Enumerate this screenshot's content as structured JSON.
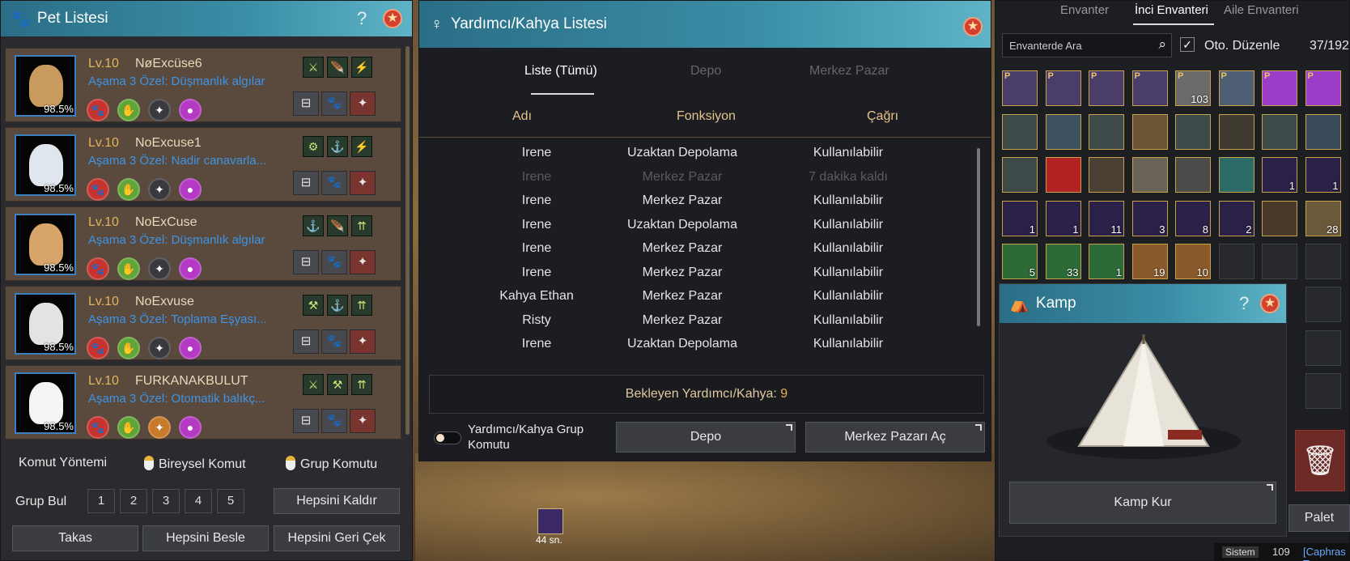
{
  "pet_list": {
    "title": "Pet Listesi",
    "help": "?",
    "pets": [
      {
        "level_prefix": "Lv.",
        "level": "10",
        "name": "NøExcüse6",
        "stage": "Aşama 3",
        "special": "Özel: Düşmanlık algılar",
        "loyalty": "98.5%",
        "color": "#c99b5e"
      },
      {
        "level_prefix": "Lv.",
        "level": "10",
        "name": "NoExcuse1",
        "stage": "Aşama 3",
        "special": "Özel: Nadir canavarla...",
        "loyalty": "98.5%",
        "color": "#dfe6ee"
      },
      {
        "level_prefix": "Lv.",
        "level": "10",
        "name": "NoExCuse",
        "stage": "Aşama 3",
        "special": "Özel: Düşmanlık algılar",
        "loyalty": "98.5%",
        "color": "#d7a46a"
      },
      {
        "level_prefix": "Lv.",
        "level": "10",
        "name": "NoExvuse",
        "stage": "Aşama 3",
        "special": "Özel: Toplama Eşyası...",
        "loyalty": "98.5%",
        "color": "#e3e3e6"
      },
      {
        "level_prefix": "Lv.",
        "level": "10",
        "name": "FURKANAKBULUT",
        "stage": "Aşama 3",
        "special": "Özel: Otomatik balıkç...",
        "loyalty": "98.5%",
        "color": "#f2f4f6"
      }
    ],
    "command_method": "Komut Yöntemi",
    "individual_command": "Bireysel Komut",
    "group_command": "Grup Komutu",
    "group_find": "Grup Bul",
    "group_numbers": [
      "1",
      "2",
      "3",
      "4",
      "5"
    ],
    "remove_all": "Hepsini Kaldır",
    "trade": "Takas",
    "feed_all": "Hepsini Besle",
    "recall_all": "Hepsini Geri Çek"
  },
  "helper_list": {
    "title": "Yardımcı/Kahya Listesi",
    "tabs": [
      "Liste (Tümü)",
      "Depo",
      "Merkez Pazar"
    ],
    "columns": [
      "Adı",
      "Fonksiyon",
      "Çağrı"
    ],
    "rows": [
      {
        "name": "Irene",
        "function": "Uzaktan Depolama",
        "status": "Kullanılabilir",
        "dim": false
      },
      {
        "name": "Irene",
        "function": "Merkez Pazar",
        "status": "7 dakika kaldı",
        "dim": true
      },
      {
        "name": "Irene",
        "function": "Merkez Pazar",
        "status": "Kullanılabilir",
        "dim": false
      },
      {
        "name": "Irene",
        "function": "Uzaktan Depolama",
        "status": "Kullanılabilir",
        "dim": false
      },
      {
        "name": "Irene",
        "function": "Merkez Pazar",
        "status": "Kullanılabilir",
        "dim": false
      },
      {
        "name": "Irene",
        "function": "Merkez Pazar",
        "status": "Kullanılabilir",
        "dim": false
      },
      {
        "name": "Kahya Ethan",
        "function": "Merkez Pazar",
        "status": "Kullanılabilir",
        "dim": false
      },
      {
        "name": "Risty",
        "function": "Merkez Pazar",
        "status": "Kullanılabilir",
        "dim": false
      },
      {
        "name": "Irene",
        "function": "Uzaktan Depolama",
        "status": "Kullanılabilir",
        "dim": false
      }
    ],
    "waiting_label": "Bekleyen Yardımcı/Kahya:",
    "waiting_count": "9",
    "group_command_line1": "Yardımcı/Kahya Grup",
    "group_command_line2": "Komutu",
    "storage_button": "Depo",
    "market_button": "Merkez Pazarı Aç"
  },
  "inventory": {
    "tabs": [
      "Envanter",
      "İnci Envanteri",
      "Aile Envanteri"
    ],
    "search_placeholder": "Envanterde Ara",
    "auto_sort": "Oto. Düzenle",
    "capacity": "37/192",
    "palette_button": "Palet",
    "quantities": [
      "",
      "",
      "",
      "",
      "103",
      "",
      "",
      "",
      "",
      "",
      "",
      "",
      "",
      "",
      "",
      "",
      "",
      "",
      "",
      "",
      "",
      "",
      "1",
      "1",
      "1",
      "1",
      "11",
      "3",
      "8",
      "2",
      "",
      "28",
      "5",
      "33",
      "1",
      "19",
      "10",
      "",
      "",
      ""
    ]
  },
  "camp": {
    "title": "Kamp",
    "help": "?",
    "setup_button": "Kamp Kur"
  },
  "hud": {
    "buff_timer": "44 sn.",
    "system_label": "Sistem",
    "count": "109",
    "chat_snippet": "[Caphras T"
  }
}
